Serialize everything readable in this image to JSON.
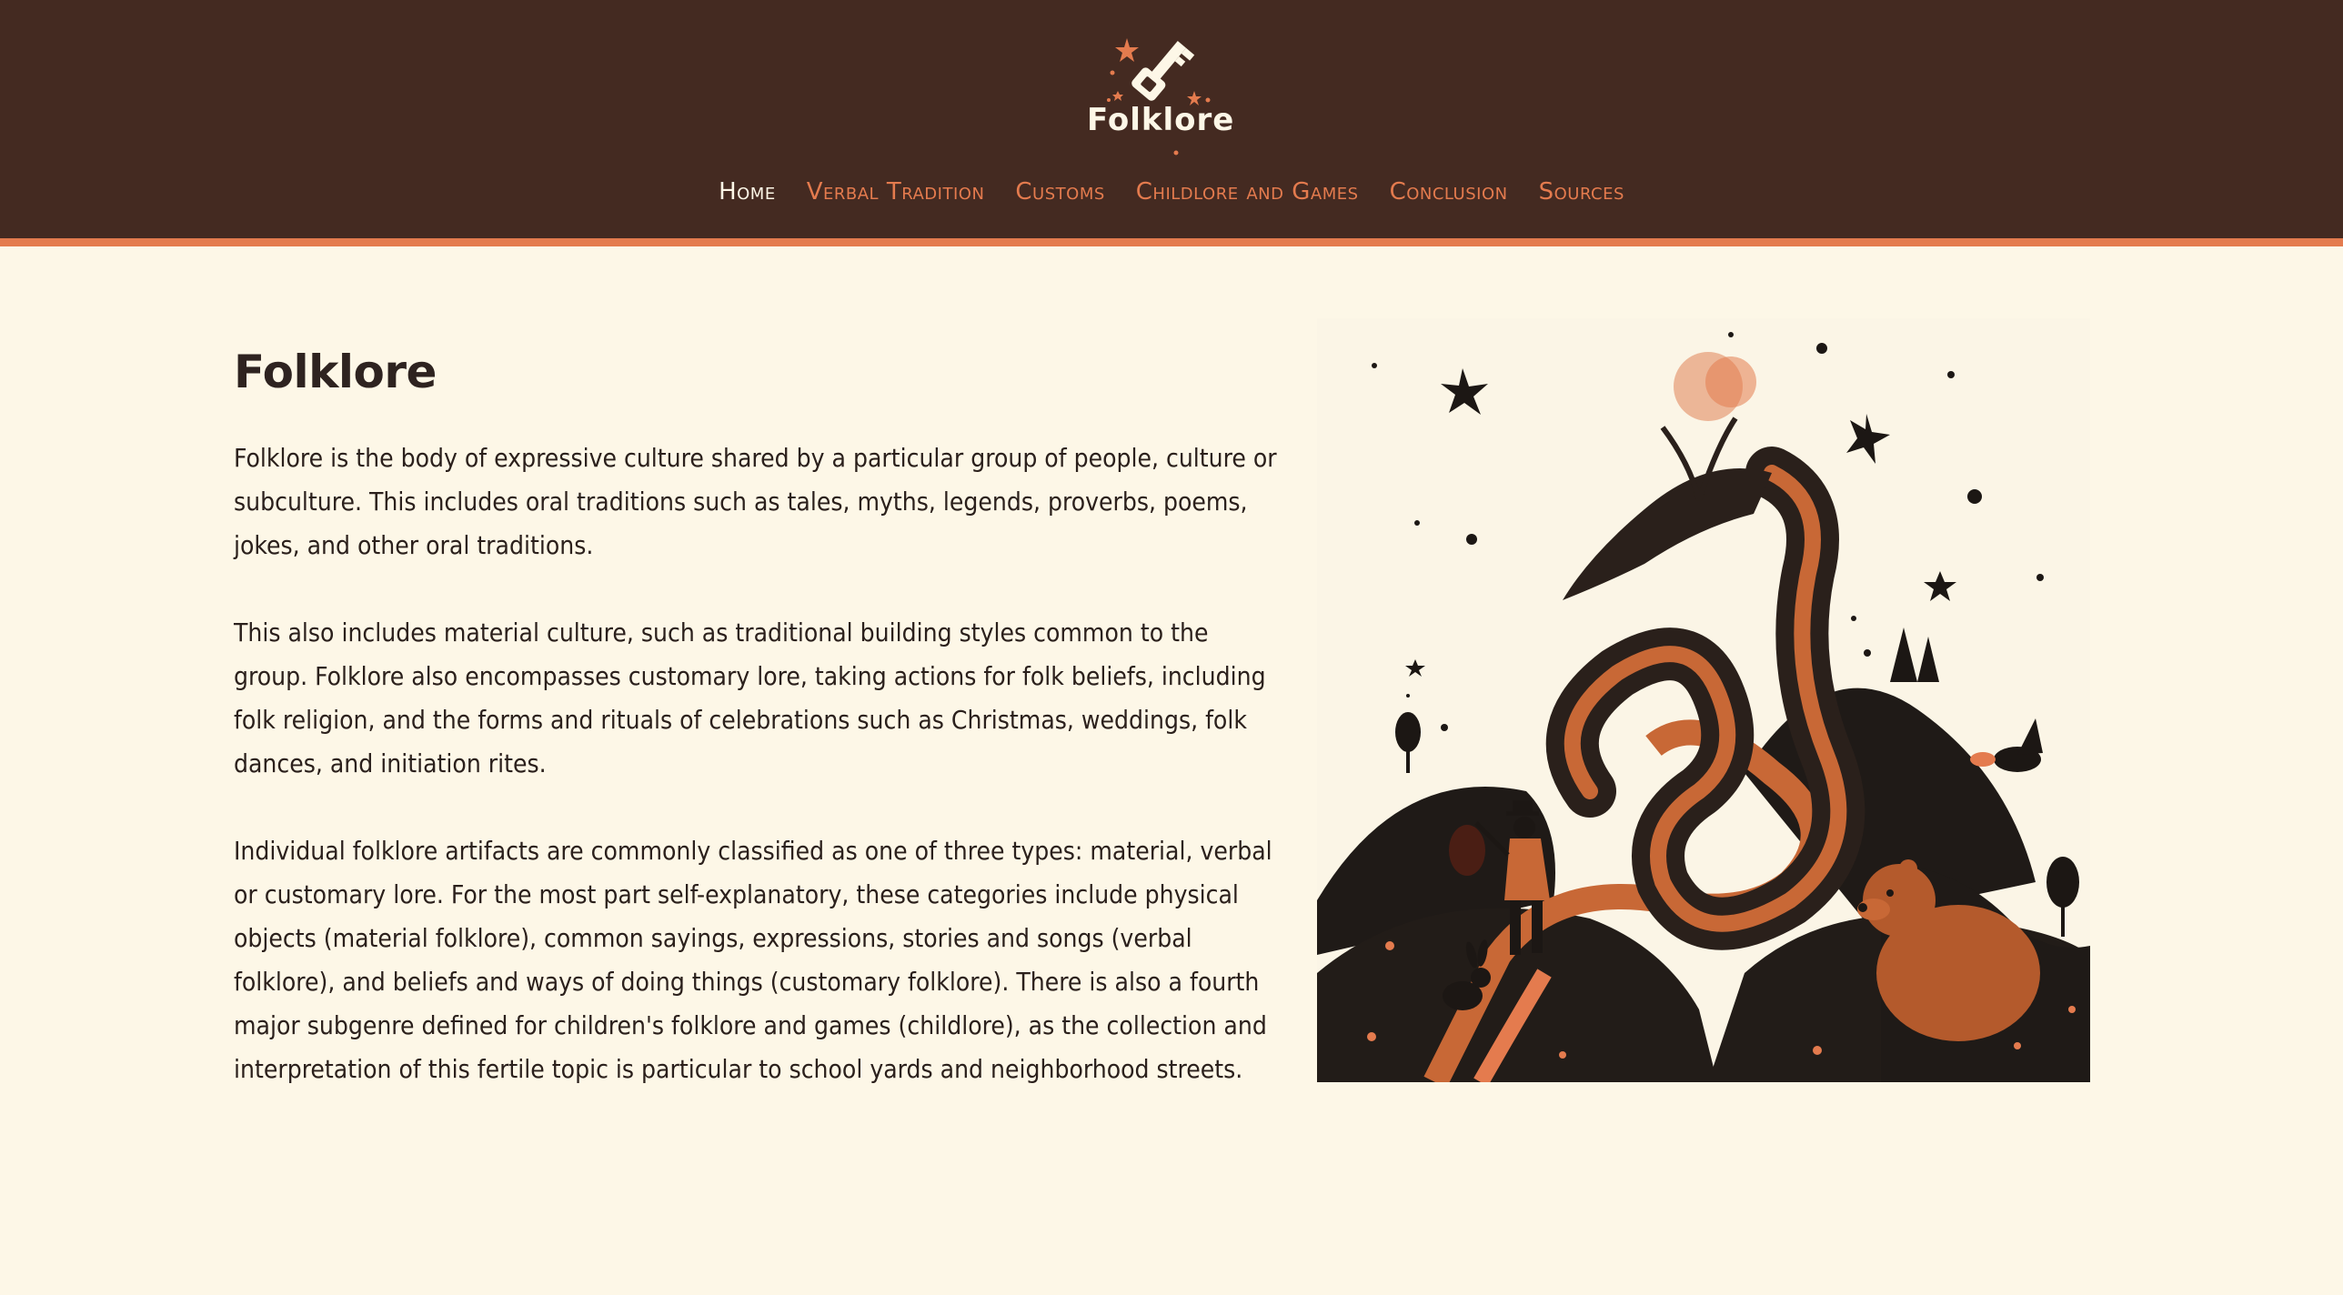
{
  "brand": {
    "logo_text": "Folklore"
  },
  "nav": {
    "items": [
      {
        "label": "Home",
        "active": true
      },
      {
        "label": "Verbal Tradition",
        "active": false
      },
      {
        "label": "Customs",
        "active": false
      },
      {
        "label": "Childlore and Games",
        "active": false
      },
      {
        "label": "Conclusion",
        "active": false
      },
      {
        "label": "Sources",
        "active": false
      }
    ]
  },
  "main": {
    "title": "Folklore",
    "paragraphs": [
      "Folklore is the body of expressive culture shared by a particular group of people, culture or subculture. This includes oral traditions such as tales, myths, legends, proverbs, poems, jokes, and other oral traditions.",
      "This also includes material culture, such as traditional building styles common to the group. Folklore also encompasses customary lore, taking actions for folk beliefs, including folk religion, and the forms and rituals of celebrations such as Christmas, weddings, folk dances, and initiation rites.",
      "Individual folklore artifacts are commonly classified as one of three types: material, verbal or customary lore. For the most part self-explanatory, these categories include physical objects (material folklore), common sayings, expressions, stories and songs (verbal folklore), and beliefs and ways of doing things (customary folklore). There is also a fourth major subgenre defined for children's folklore and games (childlore), as the collection and interpretation of this fertile topic is particular to school yards and neighborhood streets."
    ]
  },
  "colors": {
    "header_bg": "#442a21",
    "accent": "#e47b4e",
    "page_bg": "#fdf7e7",
    "text": "#2b201c"
  },
  "icons": [
    "key-icon",
    "star-icon"
  ]
}
